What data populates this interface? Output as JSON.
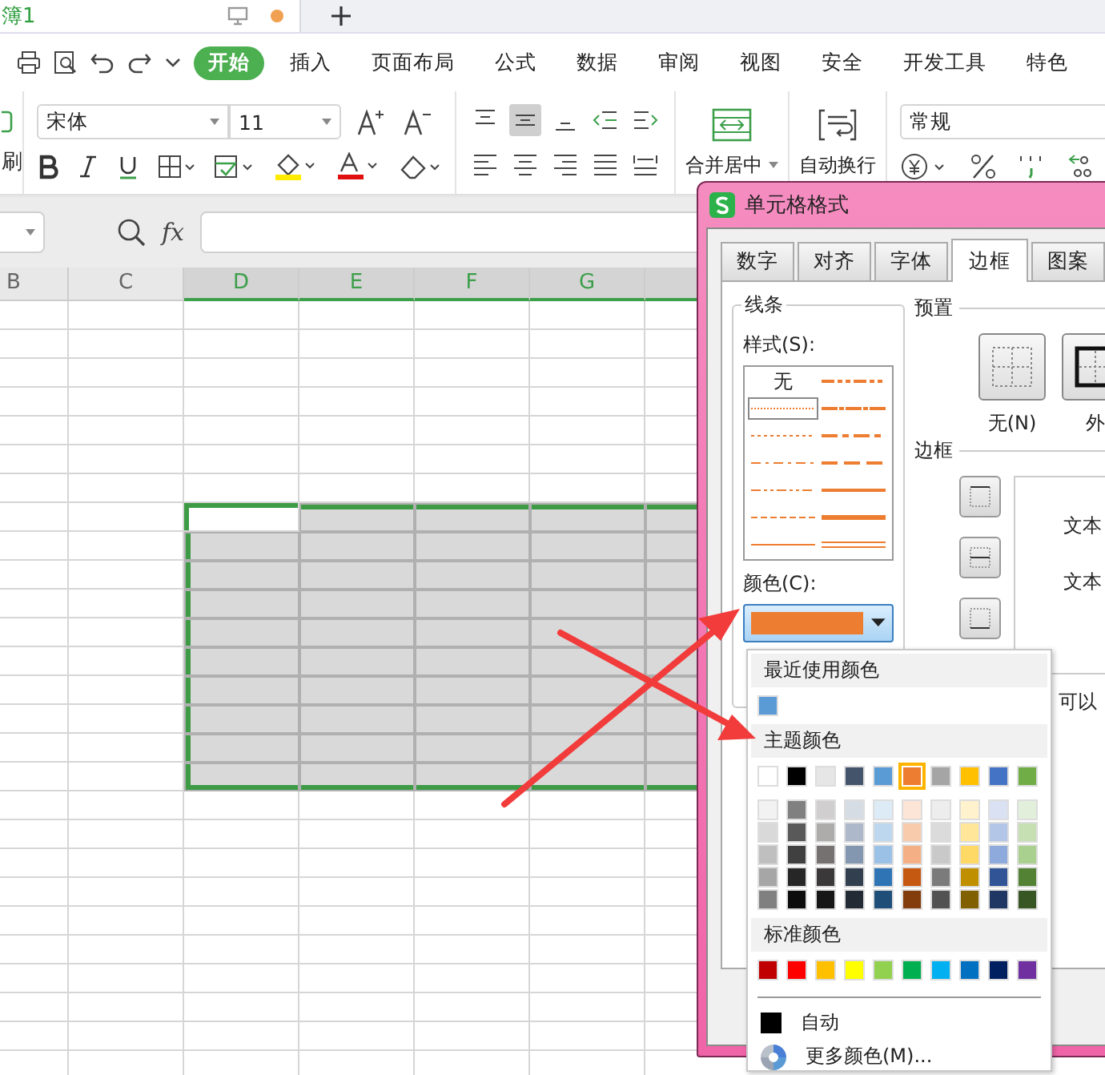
{
  "document_tab": {
    "title": "簿1"
  },
  "menu_tabs": [
    {
      "label": "开始",
      "selected": true
    },
    {
      "label": "插入",
      "selected": false
    },
    {
      "label": "页面布局",
      "selected": false
    },
    {
      "label": "公式",
      "selected": false
    },
    {
      "label": "数据",
      "selected": false
    },
    {
      "label": "审阅",
      "selected": false
    },
    {
      "label": "视图",
      "selected": false
    },
    {
      "label": "安全",
      "selected": false
    },
    {
      "label": "开发工具",
      "selected": false
    },
    {
      "label": "特色",
      "selected": false
    }
  ],
  "toolbar": {
    "format_painter": "刷",
    "font": "宋体",
    "size": "11",
    "merge": "合并居中",
    "wrap": "自动换行",
    "number_format": "常规"
  },
  "formula_bar": {
    "function_label": "fx"
  },
  "sheet": {
    "columns": [
      {
        "label": "B",
        "selected": false
      },
      {
        "label": "C",
        "selected": false
      },
      {
        "label": "D",
        "selected": true
      },
      {
        "label": "E",
        "selected": true
      },
      {
        "label": "F",
        "selected": true
      },
      {
        "label": "G",
        "selected": true
      },
      {
        "selected": true
      }
    ],
    "rows": [
      {
        "selected": false
      },
      {
        "selected": false
      },
      {
        "selected": false
      },
      {
        "selected": false
      },
      {
        "selected": false
      },
      {
        "selected": false
      },
      {
        "selected": false
      },
      {
        "selected": true
      },
      {
        "selected": true
      },
      {
        "selected": true
      },
      {
        "selected": true
      },
      {
        "selected": true
      },
      {
        "selected": true
      },
      {
        "selected": true
      },
      {
        "selected": true
      },
      {
        "selected": true
      },
      {
        "selected": true
      },
      {
        "selected": false
      },
      {
        "selected": false
      },
      {
        "selected": false
      },
      {
        "selected": false
      },
      {
        "selected": false
      },
      {
        "selected": false
      },
      {
        "selected": false
      },
      {
        "selected": false
      },
      {
        "selected": false
      },
      {
        "selected": false
      }
    ]
  },
  "dialog": {
    "title": "单元格格式",
    "tabs": [
      {
        "label": "数字",
        "selected": false
      },
      {
        "label": "对齐",
        "selected": false
      },
      {
        "label": "字体",
        "selected": false
      },
      {
        "label": "边框",
        "selected": true
      },
      {
        "label": "图案",
        "selected": false
      }
    ],
    "line_group": {
      "title": "线条",
      "style_label": "样式(S):",
      "styles": [
        {
          "kind": "none",
          "label": "无",
          "selected": false
        },
        {
          "kind": "medium_dash_dot_dot",
          "selected": false
        },
        {
          "kind": "hair",
          "selected": true
        },
        {
          "kind": "slanted_dash_dot",
          "selected": false
        },
        {
          "kind": "dotted",
          "selected": false
        },
        {
          "kind": "medium_dash_dot",
          "selected": false
        },
        {
          "kind": "dash_dot",
          "selected": false
        },
        {
          "kind": "medium_dashed",
          "selected": false
        },
        {
          "kind": "dash_dot_dot",
          "selected": false
        },
        {
          "kind": "medium",
          "selected": false
        },
        {
          "kind": "dashed",
          "selected": false
        },
        {
          "kind": "thick",
          "selected": false
        },
        {
          "kind": "thin",
          "selected": false
        },
        {
          "kind": "double",
          "selected": false
        }
      ],
      "color_label": "颜色(C):",
      "color": "#ed7d31"
    },
    "presets": {
      "title": "预置",
      "items": [
        {
          "kind": "none",
          "label": "无(N)"
        },
        {
          "kind": "outline",
          "label": "外"
        }
      ]
    },
    "border": {
      "title": "边框",
      "preview_texts": [
        "文本",
        "文本"
      ]
    },
    "hint": "可以"
  },
  "color_picker": {
    "recent_title": "最近使用颜色",
    "recent": [
      {
        "color": "#5b9bd5"
      }
    ],
    "theme_title": "主题颜色",
    "theme": [
      {
        "color": "#ffffff",
        "selected": false
      },
      {
        "color": "#000000",
        "selected": false
      },
      {
        "color": "#e7e6e6",
        "selected": false
      },
      {
        "color": "#44546a",
        "selected": false
      },
      {
        "color": "#5b9bd5",
        "selected": false
      },
      {
        "color": "#ed7d31",
        "selected": true
      },
      {
        "color": "#a5a5a5",
        "selected": false
      },
      {
        "color": "#ffc000",
        "selected": false
      },
      {
        "color": "#4472c4",
        "selected": false
      },
      {
        "color": "#70ad47",
        "selected": false
      }
    ],
    "shade_rows": [
      {
        "swatches": [
          {
            "color": "#f2f2f2"
          },
          {
            "color": "#808080"
          },
          {
            "color": "#d0cece"
          },
          {
            "color": "#d6dce4"
          },
          {
            "color": "#ddebf7"
          },
          {
            "color": "#fce4d6"
          },
          {
            "color": "#ededed"
          },
          {
            "color": "#fff2cc"
          },
          {
            "color": "#d9e1f2"
          },
          {
            "color": "#e2efda"
          }
        ]
      },
      {
        "swatches": [
          {
            "color": "#d9d9d9"
          },
          {
            "color": "#595959"
          },
          {
            "color": "#aeabab"
          },
          {
            "color": "#adb9ca"
          },
          {
            "color": "#bdd7ee"
          },
          {
            "color": "#f8cbad"
          },
          {
            "color": "#dbdbdb"
          },
          {
            "color": "#ffe699"
          },
          {
            "color": "#b4c6e7"
          },
          {
            "color": "#c6e0b4"
          }
        ]
      },
      {
        "swatches": [
          {
            "color": "#bfbfbf"
          },
          {
            "color": "#404040"
          },
          {
            "color": "#757171"
          },
          {
            "color": "#8497b0"
          },
          {
            "color": "#9bc2e6"
          },
          {
            "color": "#f4b084"
          },
          {
            "color": "#c9c9c9"
          },
          {
            "color": "#ffd966"
          },
          {
            "color": "#8ea9db"
          },
          {
            "color": "#a9d08e"
          }
        ]
      },
      {
        "swatches": [
          {
            "color": "#a6a6a6"
          },
          {
            "color": "#262626"
          },
          {
            "color": "#3a3838"
          },
          {
            "color": "#323f4f"
          },
          {
            "color": "#2f75b5"
          },
          {
            "color": "#c65911"
          },
          {
            "color": "#7b7b7b"
          },
          {
            "color": "#bf8f00"
          },
          {
            "color": "#305496"
          },
          {
            "color": "#548235"
          }
        ]
      },
      {
        "swatches": [
          {
            "color": "#808080"
          },
          {
            "color": "#0d0d0d"
          },
          {
            "color": "#171616"
          },
          {
            "color": "#222b35"
          },
          {
            "color": "#1f4e78"
          },
          {
            "color": "#833c0c"
          },
          {
            "color": "#525252"
          },
          {
            "color": "#806000"
          },
          {
            "color": "#203764"
          },
          {
            "color": "#375623"
          }
        ]
      }
    ],
    "standard_title": "标准颜色",
    "standard": [
      {
        "color": "#c00000"
      },
      {
        "color": "#ff0000"
      },
      {
        "color": "#ffc000"
      },
      {
        "color": "#ffff00"
      },
      {
        "color": "#92d050"
      },
      {
        "color": "#00b050"
      },
      {
        "color": "#00b0f0"
      },
      {
        "color": "#0070c0"
      },
      {
        "color": "#002060"
      },
      {
        "color": "#7030a0"
      }
    ],
    "auto": {
      "label": "自动",
      "color": "#000000"
    },
    "more": "更多颜色(M)..."
  }
}
